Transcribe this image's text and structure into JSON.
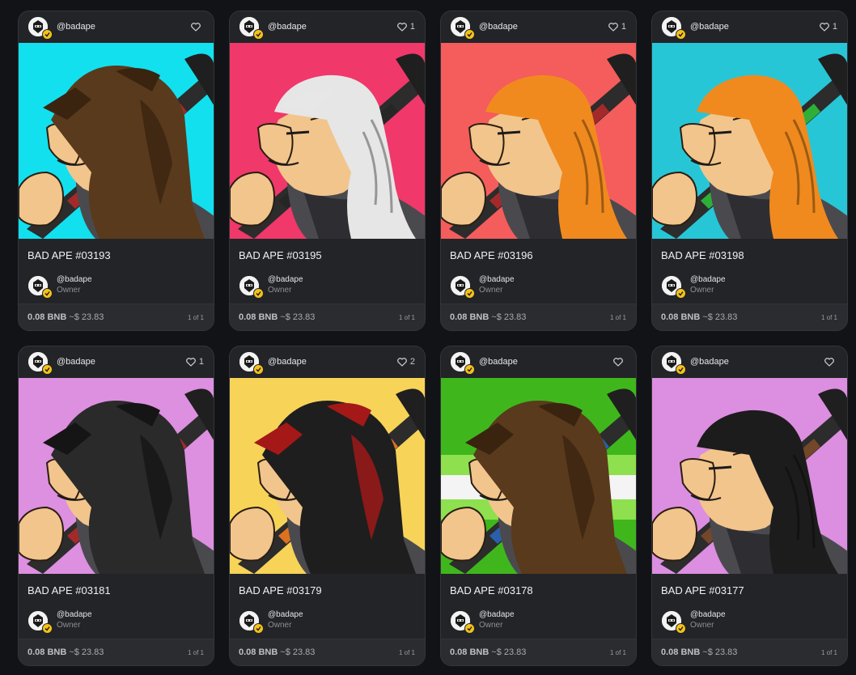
{
  "currency": "BNB",
  "cards": [
    {
      "creator": "@badape",
      "likes": "",
      "title": "BAD APE #03193",
      "owner_name": "@badape",
      "owner_role": "Owner",
      "price": "0.08 BNB",
      "usd": "~$ 23.83",
      "edition": "1 of 1",
      "bg": "#12e0ee",
      "hood": "#5a3a1c",
      "hood_dark": "#3a2410",
      "hair": null,
      "weapon_accent": "#b12a2a"
    },
    {
      "creator": "@badape",
      "likes": "1",
      "title": "BAD APE #03195",
      "owner_name": "@badape",
      "owner_role": "Owner",
      "price": "0.08 BNB",
      "usd": "~$ 23.83",
      "edition": "1 of 1",
      "bg": "#f0386a",
      "hood": null,
      "hood_dark": null,
      "hair": "#e6e6e6",
      "weapon_accent": "#262626"
    },
    {
      "creator": "@badape",
      "likes": "1",
      "title": "BAD APE #03196",
      "owner_name": "@badape",
      "owner_role": "Owner",
      "price": "0.08 BNB",
      "usd": "~$ 23.83",
      "edition": "1 of 1",
      "bg": "#f55c5c",
      "hood": null,
      "hood_dark": null,
      "hair": "#f08a1e",
      "weapon_accent": "#b12a2a"
    },
    {
      "creator": "@badape",
      "likes": "1",
      "title": "BAD APE #03198",
      "owner_name": "@badape",
      "owner_role": "Owner",
      "price": "0.08 BNB",
      "usd": "~$ 23.83",
      "edition": "1 of 1",
      "bg": "#27c6d6",
      "hood": null,
      "hood_dark": null,
      "hair": "#f08a1e",
      "weapon_accent": "#2fbf3a"
    },
    {
      "creator": "@badape",
      "likes": "1",
      "title": "BAD APE #03181",
      "owner_name": "@badape",
      "owner_role": "Owner",
      "price": "0.08 BNB",
      "usd": "~$ 23.83",
      "edition": "1 of 1",
      "bg": "#dd8fe0",
      "hood": "#2a2a2a",
      "hood_dark": "#151515",
      "hair": null,
      "weapon_accent": "#b12a2a"
    },
    {
      "creator": "@badape",
      "likes": "2",
      "title": "BAD APE #03179",
      "owner_name": "@badape",
      "owner_role": "Owner",
      "price": "0.08 BNB",
      "usd": "~$ 23.83",
      "edition": "1 of 1",
      "bg": "#f7d358",
      "hood": "#1e1e1e",
      "hood_dark": "#a51818",
      "hair": null,
      "weapon_accent": "#f07a1e"
    },
    {
      "creator": "@badape",
      "likes": "",
      "title": "BAD APE #03178",
      "owner_name": "@badape",
      "owner_role": "Owner",
      "price": "0.08 BNB",
      "usd": "~$ 23.83",
      "edition": "1 of 1",
      "bg": "#3fb71c",
      "hood": "#5a3a1c",
      "hood_dark": "#3a2410",
      "hair": null,
      "weapon_accent": "#2a66b8"
    },
    {
      "creator": "@badape",
      "likes": "",
      "title": "BAD APE #03177",
      "owner_name": "@badape",
      "owner_role": "Owner",
      "price": "0.08 BNB",
      "usd": "~$ 23.83",
      "edition": "1 of 1",
      "bg": "#dc8ee0",
      "hood": null,
      "hood_dark": null,
      "hair": "#1c1c1c",
      "weapon_accent": "#7a4a2a"
    }
  ],
  "icons": {
    "heart": "heart-icon",
    "verified": "verified-badge-icon",
    "avatar": "ape-avatar-icon"
  }
}
